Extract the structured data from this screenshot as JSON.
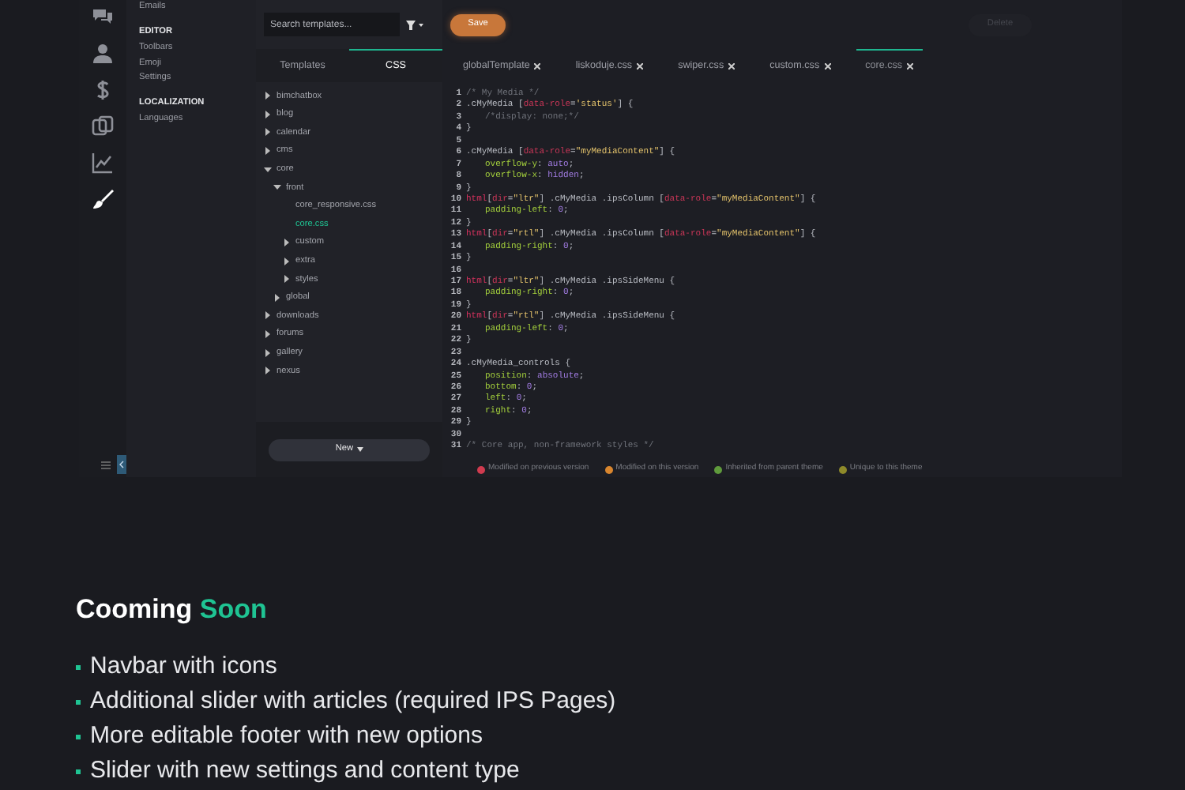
{
  "rail": {
    "items": [
      {
        "kind": "chat",
        "selected": false
      },
      {
        "kind": "person",
        "selected": false
      },
      {
        "kind": "dollar",
        "selected": false
      },
      {
        "kind": "copy",
        "selected": false
      },
      {
        "kind": "chart",
        "selected": false
      },
      {
        "kind": "brush",
        "selected": true
      }
    ]
  },
  "menu": {
    "items": [
      {
        "kind": "link",
        "label": "Emails"
      },
      {
        "kind": "heading",
        "label": "EDITOR"
      },
      {
        "kind": "link",
        "label": "Toolbars"
      },
      {
        "kind": "link",
        "label": "Emoji"
      },
      {
        "kind": "link",
        "label": "Settings"
      },
      {
        "kind": "heading",
        "label": "LOCALIZATION"
      },
      {
        "kind": "link",
        "label": "Languages"
      }
    ]
  },
  "tree_panel": {
    "search": {
      "placeholder": "Search templates..."
    },
    "tabs": [
      {
        "label": "Templates",
        "selected": false
      },
      {
        "label": "CSS",
        "selected": true
      }
    ],
    "tree": [
      {
        "kind": "folder",
        "label": "bimchatbox",
        "expanded": false,
        "selected": false
      },
      {
        "kind": "folder",
        "label": "blog",
        "expanded": false,
        "selected": false
      },
      {
        "kind": "folder",
        "label": "calendar",
        "expanded": false,
        "selected": false
      },
      {
        "kind": "folder",
        "label": "cms",
        "expanded": false,
        "selected": false
      },
      {
        "kind": "folder",
        "label": "core",
        "expanded": true,
        "selected": false,
        "children": [
          {
            "kind": "folder",
            "label": "front",
            "expanded": true,
            "selected": false,
            "children": [
              {
                "kind": "file",
                "label": "core_responsive.css",
                "selected": false
              },
              {
                "kind": "file",
                "label": "core.css",
                "selected": true
              },
              {
                "kind": "folder",
                "label": "custom",
                "expanded": false,
                "selected": false
              },
              {
                "kind": "folder",
                "label": "extra",
                "expanded": false,
                "selected": false
              },
              {
                "kind": "folder",
                "label": "styles",
                "expanded": false,
                "selected": false
              }
            ]
          },
          {
            "kind": "folder",
            "label": "global",
            "expanded": false,
            "selected": false
          }
        ]
      },
      {
        "kind": "folder",
        "label": "downloads",
        "expanded": false,
        "selected": false
      },
      {
        "kind": "folder",
        "label": "forums",
        "expanded": false,
        "selected": false
      },
      {
        "kind": "folder",
        "label": "gallery",
        "expanded": false,
        "selected": false
      },
      {
        "kind": "folder",
        "label": "nexus",
        "expanded": false,
        "selected": false
      }
    ],
    "new_button": "New"
  },
  "editor": {
    "save_button": "Save",
    "delete_button": "Delete",
    "tabs": [
      {
        "label": "globalTemplate",
        "selected": false
      },
      {
        "label": "liskoduje.css",
        "selected": false
      },
      {
        "label": "swiper.css",
        "selected": false
      },
      {
        "label": "custom.css",
        "selected": false
      },
      {
        "label": "core.css",
        "selected": true
      }
    ],
    "lines": [
      {
        "number": "1",
        "segments": [
          {
            "kind": "comment",
            "text": "/* My Media */"
          }
        ]
      },
      {
        "number": "2",
        "segments": [
          {
            "kind": "selector",
            "text": ".cMyMedia "
          },
          {
            "kind": "punct",
            "text": "["
          },
          {
            "kind": "attr",
            "text": "data-role"
          },
          {
            "kind": "punct",
            "text": "="
          },
          {
            "kind": "string",
            "text": "'status'"
          },
          {
            "kind": "punct",
            "text": "] {"
          }
        ]
      },
      {
        "number": "3",
        "indented": true,
        "segments": [
          {
            "kind": "comment",
            "text": "/*display: none;*/"
          }
        ]
      },
      {
        "number": "4",
        "segments": [
          {
            "kind": "punct",
            "text": "}"
          }
        ]
      },
      {
        "number": "5"
      },
      {
        "number": "6",
        "segments": [
          {
            "kind": "selector",
            "text": ".cMyMedia "
          },
          {
            "kind": "punct",
            "text": "["
          },
          {
            "kind": "attr",
            "text": "data-role"
          },
          {
            "kind": "punct",
            "text": "="
          },
          {
            "kind": "string",
            "text": "\"myMediaContent\""
          },
          {
            "kind": "punct",
            "text": "] {"
          }
        ]
      },
      {
        "number": "7",
        "indented": true,
        "segments": [
          {
            "kind": "prop",
            "text": "overflow-y"
          },
          {
            "kind": "punct",
            "text": ": "
          },
          {
            "kind": "value",
            "text": "auto"
          },
          {
            "kind": "punct",
            "text": ";"
          }
        ]
      },
      {
        "number": "8",
        "indented": true,
        "segments": [
          {
            "kind": "prop",
            "text": "overflow-x"
          },
          {
            "kind": "punct",
            "text": ": "
          },
          {
            "kind": "value",
            "text": "hidden"
          },
          {
            "kind": "punct",
            "text": ";"
          }
        ]
      },
      {
        "number": "9",
        "segments": [
          {
            "kind": "punct",
            "text": "}"
          }
        ]
      },
      {
        "number": "10",
        "segments": [
          {
            "kind": "tag",
            "text": "html"
          },
          {
            "kind": "punct",
            "text": "["
          },
          {
            "kind": "attr",
            "text": "dir"
          },
          {
            "kind": "punct",
            "text": "="
          },
          {
            "kind": "string",
            "text": "\"ltr\""
          },
          {
            "kind": "punct",
            "text": "] "
          },
          {
            "kind": "selector",
            "text": ".cMyMedia .ipsColumn "
          },
          {
            "kind": "punct",
            "text": "["
          },
          {
            "kind": "attr",
            "text": "data-role"
          },
          {
            "kind": "punct",
            "text": "="
          },
          {
            "kind": "string",
            "text": "\"myMediaContent\""
          },
          {
            "kind": "punct",
            "text": "] {"
          }
        ]
      },
      {
        "number": "11",
        "indented": true,
        "segments": [
          {
            "kind": "prop",
            "text": "padding-left"
          },
          {
            "kind": "punct",
            "text": ": "
          },
          {
            "kind": "value",
            "text": "0"
          },
          {
            "kind": "punct",
            "text": ";"
          }
        ]
      },
      {
        "number": "12",
        "segments": [
          {
            "kind": "punct",
            "text": "}"
          }
        ]
      },
      {
        "number": "13",
        "segments": [
          {
            "kind": "tag",
            "text": "html"
          },
          {
            "kind": "punct",
            "text": "["
          },
          {
            "kind": "attr",
            "text": "dir"
          },
          {
            "kind": "punct",
            "text": "="
          },
          {
            "kind": "string",
            "text": "\"rtl\""
          },
          {
            "kind": "punct",
            "text": "] "
          },
          {
            "kind": "selector",
            "text": ".cMyMedia .ipsColumn "
          },
          {
            "kind": "punct",
            "text": "["
          },
          {
            "kind": "attr",
            "text": "data-role"
          },
          {
            "kind": "punct",
            "text": "="
          },
          {
            "kind": "string",
            "text": "\"myMediaContent\""
          },
          {
            "kind": "punct",
            "text": "] {"
          }
        ]
      },
      {
        "number": "14",
        "indented": true,
        "segments": [
          {
            "kind": "prop",
            "text": "padding-right"
          },
          {
            "kind": "punct",
            "text": ": "
          },
          {
            "kind": "value",
            "text": "0"
          },
          {
            "kind": "punct",
            "text": ";"
          }
        ]
      },
      {
        "number": "15",
        "segments": [
          {
            "kind": "punct",
            "text": "}"
          }
        ]
      },
      {
        "number": "16"
      },
      {
        "number": "17",
        "segments": [
          {
            "kind": "tag",
            "text": "html"
          },
          {
            "kind": "punct",
            "text": "["
          },
          {
            "kind": "attr",
            "text": "dir"
          },
          {
            "kind": "punct",
            "text": "="
          },
          {
            "kind": "string",
            "text": "\"ltr\""
          },
          {
            "kind": "punct",
            "text": "] "
          },
          {
            "kind": "selector",
            "text": ".cMyMedia .ipsSideMenu {"
          }
        ]
      },
      {
        "number": "18",
        "indented": true,
        "segments": [
          {
            "kind": "prop",
            "text": "padding-right"
          },
          {
            "kind": "punct",
            "text": ": "
          },
          {
            "kind": "value",
            "text": "0"
          },
          {
            "kind": "punct",
            "text": ";"
          }
        ]
      },
      {
        "number": "19",
        "segments": [
          {
            "kind": "punct",
            "text": "}"
          }
        ]
      },
      {
        "number": "20",
        "segments": [
          {
            "kind": "tag",
            "text": "html"
          },
          {
            "kind": "punct",
            "text": "["
          },
          {
            "kind": "attr",
            "text": "dir"
          },
          {
            "kind": "punct",
            "text": "="
          },
          {
            "kind": "string",
            "text": "\"rtl\""
          },
          {
            "kind": "punct",
            "text": "] "
          },
          {
            "kind": "selector",
            "text": ".cMyMedia .ipsSideMenu {"
          }
        ]
      },
      {
        "number": "21",
        "indented": true,
        "segments": [
          {
            "kind": "prop",
            "text": "padding-left"
          },
          {
            "kind": "punct",
            "text": ": "
          },
          {
            "kind": "value",
            "text": "0"
          },
          {
            "kind": "punct",
            "text": ";"
          }
        ]
      },
      {
        "number": "22",
        "segments": [
          {
            "kind": "punct",
            "text": "}"
          }
        ]
      },
      {
        "number": "23"
      },
      {
        "number": "24",
        "segments": [
          {
            "kind": "selector",
            "text": ".cMyMedia_controls {"
          }
        ]
      },
      {
        "number": "25",
        "indented": true,
        "segments": [
          {
            "kind": "prop",
            "text": "position"
          },
          {
            "kind": "punct",
            "text": ": "
          },
          {
            "kind": "value",
            "text": "absolute"
          },
          {
            "kind": "punct",
            "text": ";"
          }
        ]
      },
      {
        "number": "26",
        "indented": true,
        "segments": [
          {
            "kind": "prop",
            "text": "bottom"
          },
          {
            "kind": "punct",
            "text": ": "
          },
          {
            "kind": "value",
            "text": "0"
          },
          {
            "kind": "punct",
            "text": ";"
          }
        ]
      },
      {
        "number": "27",
        "indented": true,
        "segments": [
          {
            "kind": "prop",
            "text": "left"
          },
          {
            "kind": "punct",
            "text": ": "
          },
          {
            "kind": "value",
            "text": "0"
          },
          {
            "kind": "punct",
            "text": ";"
          }
        ]
      },
      {
        "number": "28",
        "indented": true,
        "segments": [
          {
            "kind": "prop",
            "text": "right"
          },
          {
            "kind": "punct",
            "text": ": "
          },
          {
            "kind": "value",
            "text": "0"
          },
          {
            "kind": "punct",
            "text": ";"
          }
        ]
      },
      {
        "number": "29",
        "segments": [
          {
            "kind": "punct",
            "text": "}"
          }
        ]
      },
      {
        "number": "30"
      },
      {
        "number": "31",
        "segments": [
          {
            "kind": "comment",
            "text": "/* Core app, non-framework styles */"
          }
        ]
      }
    ],
    "legend": [
      {
        "label": "Modified on previous version",
        "color": "#d03b4f"
      },
      {
        "label": "Modified on this version",
        "color": "#d9862e"
      },
      {
        "label": "Inherited from parent theme",
        "color": "#5f9a3c"
      },
      {
        "label": "Unique to this theme",
        "color": "#8e8a2a"
      }
    ]
  },
  "coming_soon": {
    "title": "Cooming",
    "title_accent": "Soon",
    "items": [
      "Navbar with icons",
      "Additional slider with articles (required IPS Pages)",
      "More editable footer with new options",
      "Slider with new settings and content type"
    ]
  }
}
